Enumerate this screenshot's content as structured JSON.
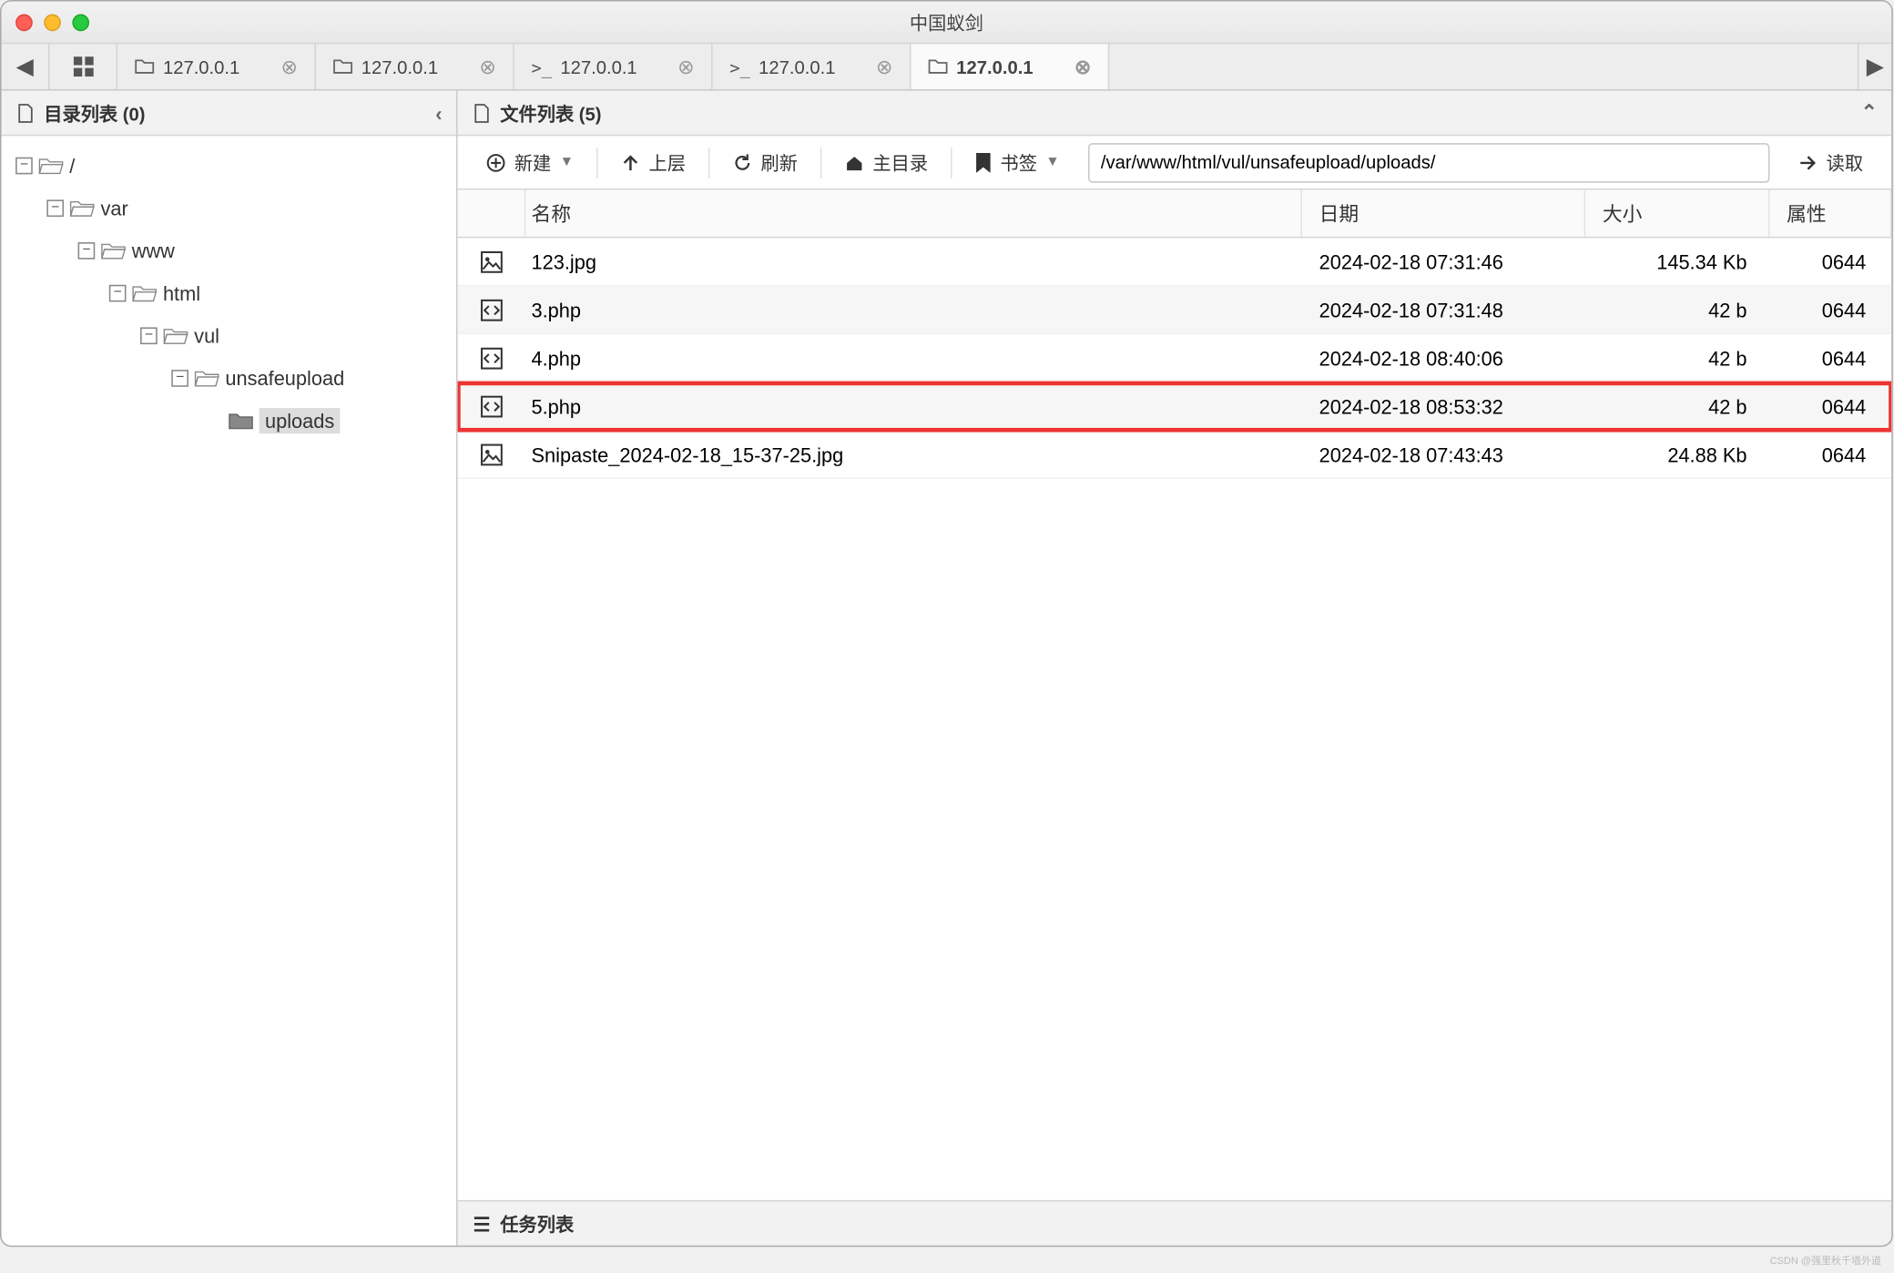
{
  "window": {
    "title": "中国蚁剑"
  },
  "tabs": [
    {
      "icon": "folder",
      "label": "127.0.0.1",
      "active": false
    },
    {
      "icon": "folder",
      "label": "127.0.0.1",
      "active": false
    },
    {
      "icon": "terminal",
      "label": "127.0.0.1",
      "active": false
    },
    {
      "icon": "terminal",
      "label": "127.0.0.1",
      "active": false
    },
    {
      "icon": "folder",
      "label": "127.0.0.1",
      "active": true
    }
  ],
  "sidebar": {
    "title": "目录列表 (0)",
    "tree": [
      {
        "level": 0,
        "exp": "-",
        "icon": "folder-open",
        "label": "/"
      },
      {
        "level": 1,
        "exp": "-",
        "icon": "folder-open",
        "label": "var"
      },
      {
        "level": 2,
        "exp": "-",
        "icon": "folder-open",
        "label": "www"
      },
      {
        "level": 3,
        "exp": "-",
        "icon": "folder-open",
        "label": "html"
      },
      {
        "level": 4,
        "exp": "-",
        "icon": "folder-open",
        "label": "vul"
      },
      {
        "level": 5,
        "exp": "-",
        "icon": "folder-open",
        "label": "unsafeupload"
      },
      {
        "level": 6,
        "exp": "",
        "icon": "folder-sel",
        "label": "uploads",
        "selected": true
      }
    ]
  },
  "content": {
    "title": "文件列表 (5)",
    "toolbar": {
      "new": "新建",
      "up": "上层",
      "refresh": "刷新",
      "home": "主目录",
      "bookmark": "书签",
      "path": "/var/www/html/vul/unsafeupload/uploads/",
      "read": "读取"
    },
    "columns": {
      "name": "名称",
      "date": "日期",
      "size": "大小",
      "attr": "属性"
    },
    "rows": [
      {
        "icon": "image",
        "name": "123.jpg",
        "date": "2024-02-18 07:31:46",
        "size": "145.34 Kb",
        "attr": "0644"
      },
      {
        "icon": "code",
        "name": "3.php",
        "date": "2024-02-18 07:31:48",
        "size": "42 b",
        "attr": "0644"
      },
      {
        "icon": "code",
        "name": "4.php",
        "date": "2024-02-18 08:40:06",
        "size": "42 b",
        "attr": "0644"
      },
      {
        "icon": "code",
        "name": "5.php",
        "date": "2024-02-18 08:53:32",
        "size": "42 b",
        "attr": "0644",
        "highlight": true
      },
      {
        "icon": "image",
        "name": "Snipaste_2024-02-18_15-37-25.jpg",
        "date": "2024-02-18 07:43:43",
        "size": "24.88 Kb",
        "attr": "0644"
      }
    ]
  },
  "footer": {
    "title": "任务列表"
  },
  "watermark": "CSDN @强里秋千墙外道"
}
